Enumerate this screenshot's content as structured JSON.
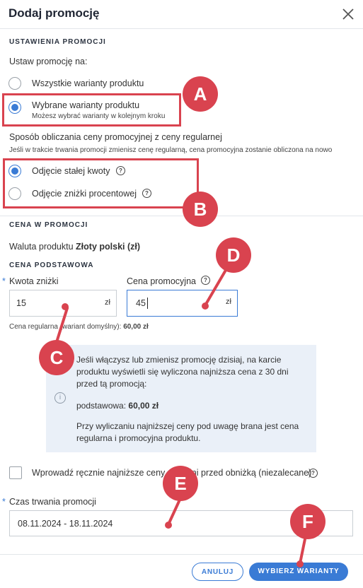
{
  "dialog": {
    "title": "Dodaj promocję",
    "close_icon": "close-icon"
  },
  "settings": {
    "section_label": "USTAWIENIA PROMOCJI",
    "apply_label": "Ustaw promocję na:",
    "option_all": "Wszystkie warianty produktu",
    "option_selected": "Wybrane warianty produktu",
    "option_selected_hint": "Możesz wybrać warianty w kolejnym kroku",
    "selected_option": "option_selected",
    "calc_label": "Sposób obliczania ceny promocyjnej z ceny regularnej",
    "calc_hint": "Jeśli w trakcie trwania promocji zmienisz cenę regularną, cena promocyjna zostanie obliczona na nowo",
    "calc_fixed": "Odjęcie stałej kwoty",
    "calc_percent": "Odjęcie zniżki procentowej",
    "selected_calc": "calc_fixed"
  },
  "price": {
    "section_label": "CENA W PROMOCJI",
    "currency_prefix": "Waluta produktu",
    "currency_value": "Złoty polski (zł)",
    "base_label": "CENA PODSTAWOWA",
    "discount_label": "Kwota zniżki",
    "discount_value": "15",
    "discount_unit": "zł",
    "promo_label": "Cena promocyjna",
    "promo_value": "45",
    "promo_unit": "zł",
    "regular_note_prefix": "Cena regularna (wariant domyślny):",
    "regular_note_value": "60,00 zł",
    "required_mark": "*"
  },
  "info": {
    "line1": "Jeśli włączysz lub zmienisz promocję dzisiaj, na karcie produktu wyświetli się wyliczona najniższa cena z 30 dni przed tą promocją:",
    "base_prefix": "podstawowa:",
    "base_value": "60,00 zł",
    "line2": "Przy wyliczaniu najniższej ceny pod uwagę brana jest cena regularna i promocyjna produktu.",
    "icon_text": "i"
  },
  "manual": {
    "label": "Wprowadź ręcznie najniższe ceny z 30 dni przed obniżką (niezalecane)",
    "checked": false
  },
  "duration": {
    "label": "Czas trwania promocji",
    "value": "08.11.2024 - 18.11.2024"
  },
  "footer": {
    "cancel_label": "ANULUJ",
    "submit_label": "WYBIERZ WARIANTY"
  },
  "annotations": {
    "A": "A",
    "B": "B",
    "C": "C",
    "D": "D",
    "E": "E",
    "F": "F",
    "color": "#d9434f"
  },
  "colors": {
    "accent": "#3a7bd5",
    "info_bg": "#eaf0f8"
  }
}
